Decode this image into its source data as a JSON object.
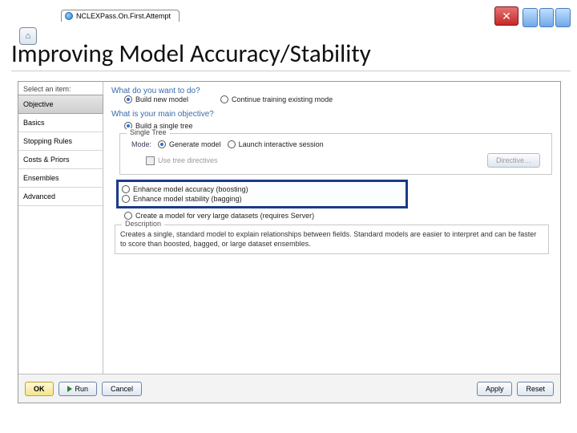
{
  "window": {
    "tab_title": "NCLEXPass.On.First.Attempt"
  },
  "slide": {
    "title": "Improving Model Accuracy/Stability"
  },
  "dialog": {
    "sidebar": {
      "header": "Select an item:",
      "items": [
        {
          "label": "Objective",
          "selected": true
        },
        {
          "label": "Basics",
          "selected": false
        },
        {
          "label": "Stopping Rules",
          "selected": false
        },
        {
          "label": "Costs & Priors",
          "selected": false
        },
        {
          "label": "Ensembles",
          "selected": false
        },
        {
          "label": "Advanced",
          "selected": false
        }
      ]
    },
    "section1": {
      "question": "What do you want to do?",
      "opt_build": "Build new model",
      "opt_cont": "Continue training existing mode"
    },
    "section2": {
      "question": "What is your main objective?",
      "opt_single": "Build a single tree",
      "group_label": "Single Tree",
      "mode_label": "Mode:",
      "opt_gen": "Generate model",
      "opt_launch": "Launch interactive session",
      "chk_directives": "Use tree directives",
      "btn_directive": "Directive…",
      "opt_boost": "Enhance model accuracy (boosting)",
      "opt_bag": "Enhance model stability (bagging)",
      "opt_large": "Create a model for very large datasets (requires Server)"
    },
    "description": {
      "label": "Description",
      "text": "Creates a single, standard model to explain relationships between fields. Standard models are easier to interpret and can be faster to score than boosted, bagged, or large dataset ensembles."
    },
    "buttons": {
      "ok": "OK",
      "run": "Run",
      "cancel": "Cancel",
      "apply": "Apply",
      "reset": "Reset"
    }
  }
}
